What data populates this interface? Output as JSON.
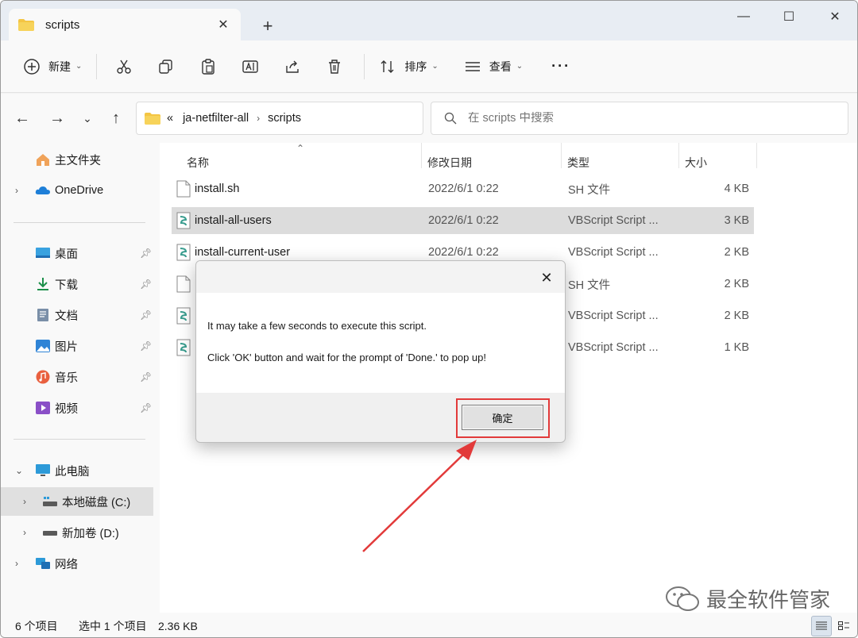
{
  "titlebar": {
    "tab_title": "scripts",
    "tab_close": "✕",
    "new_tab": "+",
    "minimize": "—",
    "maximize": "☐",
    "close": "✕"
  },
  "toolbar": {
    "new_label": "新建",
    "sort_label": "排序",
    "view_label": "查看",
    "more_label": "···"
  },
  "address": {
    "overflow": "«",
    "crumbs": [
      "ja-netfilter-all",
      "scripts"
    ],
    "separator": "›"
  },
  "search": {
    "placeholder": "在 scripts 中搜索"
  },
  "sidebar": {
    "home": "主文件夹",
    "onedrive": "OneDrive",
    "quick": [
      "桌面",
      "下载",
      "文档",
      "图片",
      "音乐",
      "视频"
    ],
    "thispc": "此电脑",
    "drive_c": "本地磁盘 (C:)",
    "drive_d": "新加卷 (D:)",
    "network": "网络"
  },
  "columns": {
    "name": "名称",
    "date": "修改日期",
    "type": "类型",
    "size": "大小"
  },
  "files": [
    {
      "name": "install.sh",
      "date": "2022/6/1 0:22",
      "type": "SH 文件",
      "size": "4 KB"
    },
    {
      "name": "install-all-users",
      "date": "2022/6/1 0:22",
      "type": "VBScript Script ...",
      "size": "3 KB"
    },
    {
      "name": "install-current-user",
      "date": "2022/6/1 0:22",
      "type": "VBScript Script ...",
      "size": "2 KB"
    },
    {
      "name": "",
      "date": "",
      "type": "SH 文件",
      "size": "2 KB"
    },
    {
      "name": "",
      "date": "",
      "type": "VBScript Script ...",
      "size": "2 KB"
    },
    {
      "name": "",
      "date": "",
      "type": "VBScript Script ...",
      "size": "1 KB"
    }
  ],
  "status": {
    "count": "6 个项目",
    "selected": "选中 1 个项目",
    "size": "2.36 KB"
  },
  "dialog": {
    "message1": "It may take a few seconds to execute this script.",
    "message2": "Click 'OK' button and wait for the prompt of 'Done.' to pop up!",
    "ok_label": "确定",
    "close": "✕"
  },
  "watermark": "最全软件管家",
  "colors": {
    "accent_red": "#e23a3a",
    "folder": "#f4c543",
    "selection": "#dcdcdc"
  }
}
